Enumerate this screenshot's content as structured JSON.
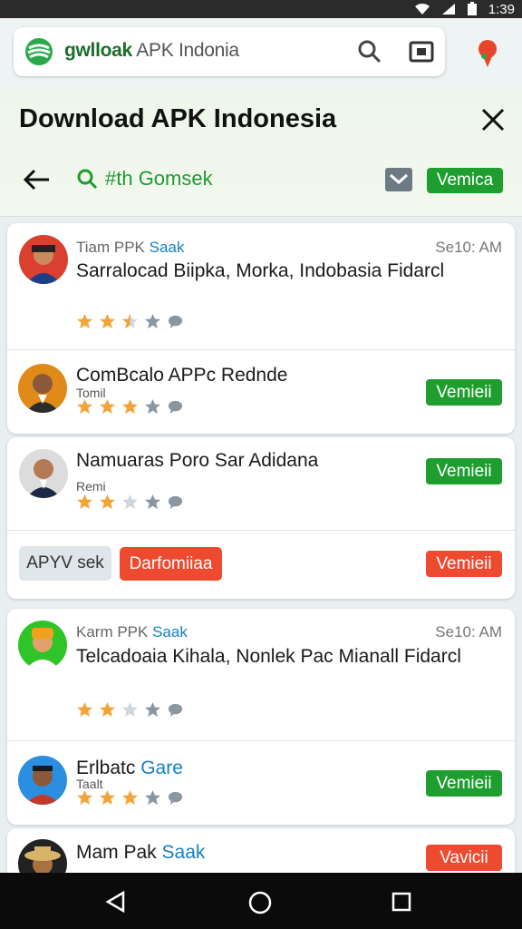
{
  "status": {
    "time": "1:39"
  },
  "browser": {
    "url_brand": "gwlloak",
    "url_rest": " APK Indonia"
  },
  "header": {
    "title": "Download APK Indonesia",
    "search": "#th Gomsek",
    "action": "Vemica"
  },
  "cards": [
    {
      "meta_prefix": "Tiam PPK",
      "meta_tag": "Saak",
      "time": "Se10: AM",
      "name": "Sarralocad Biipka, Morka, Indobasia Fidarcl",
      "rating": 2.5,
      "avatar_color": "#d9402f"
    },
    {
      "name": "ComBcalo APPc Rednde",
      "sub": "Tomil",
      "button": "Vemieii",
      "rating": 3,
      "avatar_color": "#e08a1a"
    },
    {
      "name": "Namuaras Poro Sar Adidana",
      "sub": "Remi",
      "button": "Vemieii",
      "rating": 2,
      "avatar_color": "#dcdcdc",
      "chip1": "APYV sek",
      "chip2": "Darfomiiaa",
      "button2": "Vemieii"
    },
    {
      "meta_prefix": "Karm PPK",
      "meta_tag": "Saak",
      "time": "Se10: AM",
      "name": "Telcadoaia Kihala, Nonlek Pac Mianall Fidarcl",
      "rating": 2,
      "avatar_color": "#2fc428"
    },
    {
      "name": "Erlbatc",
      "name_tag": "Gare",
      "sub": "Taalt",
      "button": "Vemieii",
      "rating": 3,
      "avatar_color": "#2a8fe0"
    },
    {
      "name": "Mam Pak",
      "name_tag": "Saak",
      "button": "Vavicii",
      "avatar_color": "#222"
    }
  ],
  "colors": {
    "green": "#1e9e2f",
    "red": "#ee4a2f",
    "star": "#f2a43a",
    "blue": "#1680c4"
  }
}
